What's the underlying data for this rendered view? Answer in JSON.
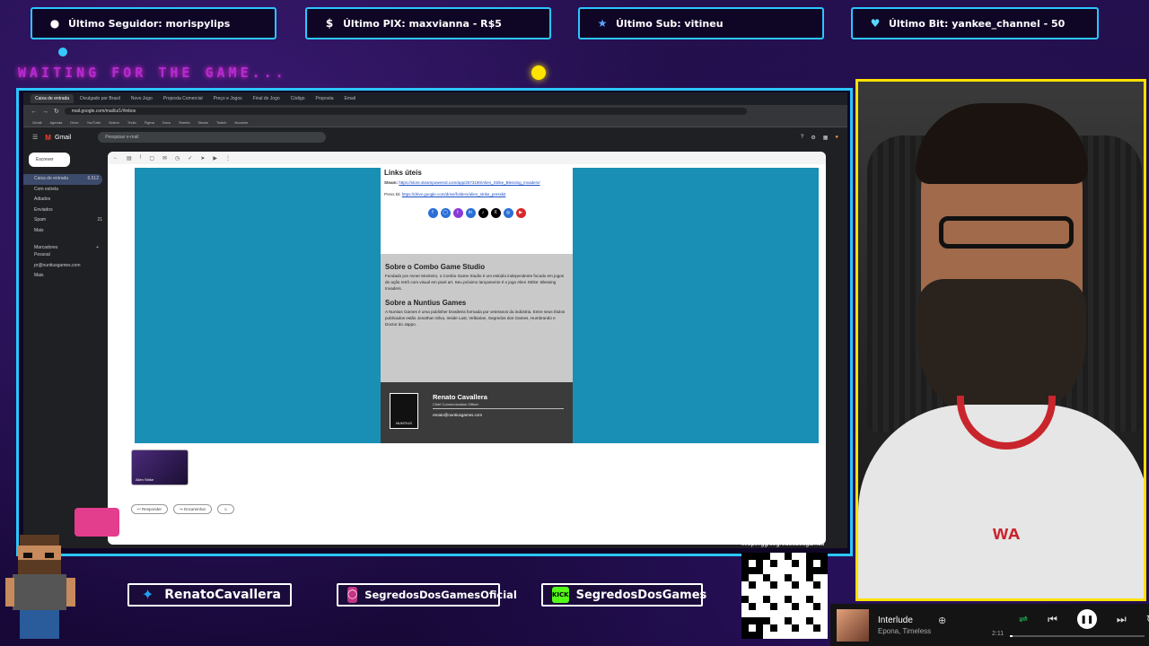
{
  "alerts": [
    {
      "icon": "user-icon",
      "text": "Último Seguidor: morispylips"
    },
    {
      "icon": "dollar-icon",
      "text": "Último PIX: maxvianna - R$5"
    },
    {
      "icon": "star-icon",
      "text": "Último Sub: vitineu"
    },
    {
      "icon": "heart-icon",
      "text": "Último Bit: yankee_channel - 50"
    }
  ],
  "overlay": {
    "waiting_text": "WAITING FOR THE GAME..."
  },
  "browser": {
    "tabs": [
      "Caixa de entrada",
      "Divulgado por Brasil",
      "Novo Jogo",
      "Proposta Comercial",
      "Preço e Jogos",
      "Final do Jogo",
      "Código",
      "Proposta",
      "Email"
    ],
    "url": "mail.google.com/mail/u/1/#inbox",
    "bookmarks": [
      "Gmail",
      "Agenda",
      "Drive",
      "YouTube",
      "Notion",
      "Trello",
      "Figma",
      "Docs",
      "Sheets",
      "Steam",
      "Twitch",
      "Nuuvem"
    ]
  },
  "gmail": {
    "app_name": "Gmail",
    "search_placeholder": "Pesquisar e-mail",
    "compose_label": "Escrever",
    "sidebar": [
      {
        "label": "Caixa de entrada",
        "count": "6.512"
      },
      {
        "label": "Com estrela",
        "count": ""
      },
      {
        "label": "Adiados",
        "count": ""
      },
      {
        "label": "Enviados",
        "count": ""
      },
      {
        "label": "Spam",
        "count": "21"
      },
      {
        "label": "Mais",
        "count": ""
      }
    ],
    "labels_title": "Marcadores",
    "labels": [
      "Pessoal",
      "pr@nuntiusgames.com",
      "Mais"
    ],
    "links_title": "Links úteis",
    "steam_label": "Steam:",
    "steam_link": "https://store.steampowered.com/app/2573190/Alien_Strike_Blessing_Invaders/",
    "presskit_label": "Press kit:",
    "presskit_link": "https://drive.google.com/drive/folders/alien_strike_presskit",
    "social_icons": [
      "facebook-icon",
      "instagram-icon",
      "twitch-icon",
      "linkedin-icon",
      "tiktok-icon",
      "x-icon",
      "web-icon",
      "youtube-icon"
    ],
    "about_combo_title": "Sobre o Combo Game Studio",
    "about_combo_text": "Fundado por Avner Monteiro, o Combo Game Studio é um estúdio independente focado em jogos de ação retrô com visual em pixel art. Seu próximo lançamento é o jogo Alien Strike: Blessing Invaders.",
    "about_nuntius_title": "Sobre a Nuntius Games",
    "about_nuntius_text": "A Nuntius Games é uma publisher brasileira formada por veteranos da indústria. Entre seus títulos publicados estão Jonathan Silva, Inside Last, Velbarian, Segredos dos Games, Humbrando e Doctor do Jappo.",
    "signature_name": "Renato Cavallera",
    "signature_role": "Chief Communication Officer",
    "signature_email": "renato@nuntiusgames.com",
    "signature_logo": "NUNTIUS",
    "attachment_caption": "Alien Strike",
    "reply_label": "Responder",
    "forward_label": "Encaminhar"
  },
  "socials": [
    {
      "icon": "twitter-icon",
      "text": "RenatoCavallera"
    },
    {
      "icon": "instagram-icon",
      "text": "SegredosDosGamesOficial"
    },
    {
      "icon": "kick-icon",
      "text": "SegredosDosGames"
    }
  ],
  "qr": {
    "label": "livepix.gg/segredosdosgames"
  },
  "player": {
    "track": "Interlude",
    "artist": "Epona, Timeless",
    "elapsed": "2:11",
    "progress": 0.02
  },
  "colors": {
    "accent": "#2bc6ff",
    "cam_border": "#ffe000",
    "email_background": "#1a8fb5"
  }
}
